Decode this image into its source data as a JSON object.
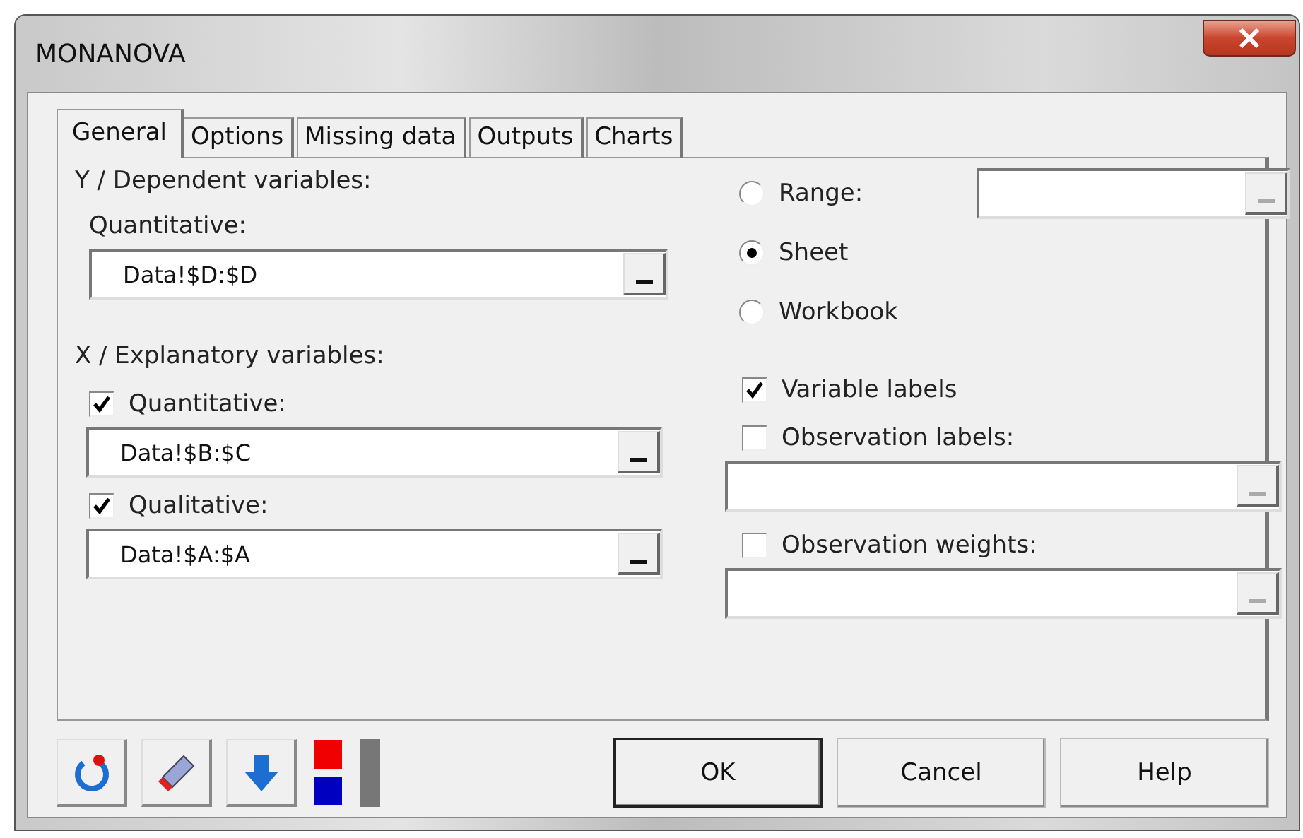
{
  "window": {
    "title": "MONANOVA"
  },
  "tabs": [
    {
      "label": "General",
      "selected": true
    },
    {
      "label": "Options",
      "selected": false
    },
    {
      "label": "Missing data",
      "selected": false
    },
    {
      "label": "Outputs",
      "selected": false
    },
    {
      "label": "Charts",
      "selected": false
    }
  ],
  "dependent": {
    "heading": "Y / Dependent variables:",
    "label": "Quantitative:",
    "value": "Data!$D:$D"
  },
  "explanatory": {
    "heading": "X / Explanatory variables:",
    "items": [
      {
        "label": "Quantitative:",
        "checked": true,
        "value": "Data!$B:$C"
      },
      {
        "label": "Qualitative:",
        "checked": true,
        "value": "Data!$A:$A"
      }
    ]
  },
  "scope": [
    {
      "label": "Range:",
      "selected": false,
      "kind": "range"
    },
    {
      "label": "Sheet",
      "selected": true,
      "kind": "plain"
    },
    {
      "label": "Workbook",
      "selected": false,
      "kind": "plain"
    }
  ],
  "options": [
    {
      "label": "Variable labels",
      "checked": true,
      "kind": "plain"
    },
    {
      "label": "Observation labels:",
      "checked": false,
      "kind": "field"
    },
    {
      "label": "Observation weights:",
      "checked": false,
      "kind": "field"
    }
  ],
  "buttons": [
    {
      "label": "OK",
      "default": true
    },
    {
      "label": "Cancel",
      "default": false
    },
    {
      "label": "Help",
      "default": false
    }
  ]
}
